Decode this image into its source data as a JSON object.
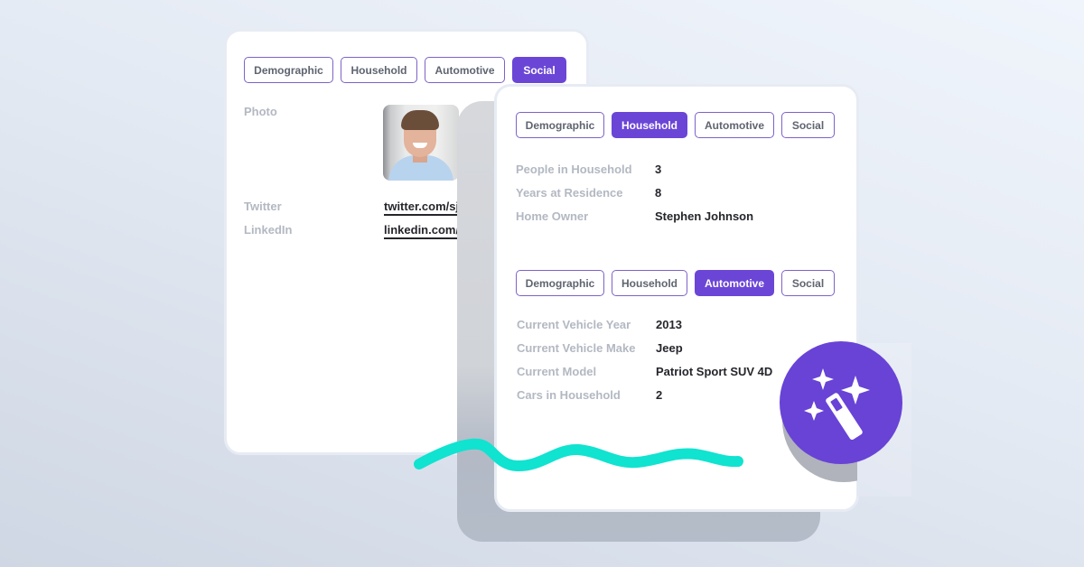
{
  "colors": {
    "accent": "#6b46d6",
    "tab_border": "#7e63c8",
    "label_text": "#b3b8c2",
    "value_text": "#25262b",
    "squiggle": "#10e3d0",
    "background_light": "#f0f5fc",
    "background_dark": "#cfd7e4"
  },
  "social_card": {
    "tabs": [
      {
        "label": "Demographic",
        "active": false
      },
      {
        "label": "Household",
        "active": false
      },
      {
        "label": "Automotive",
        "active": false
      },
      {
        "label": "Social",
        "active": true
      }
    ],
    "fields": {
      "photo_label": "Photo",
      "twitter_label": "Twitter",
      "twitter_value": "twitter.com/sjohnson",
      "linkedin_label": "LinkedIn",
      "linkedin_value": "linkedin.com/in/stephenjohnson"
    }
  },
  "household_panel": {
    "tabs": [
      {
        "label": "Demographic",
        "active": false
      },
      {
        "label": "Household",
        "active": true
      },
      {
        "label": "Automotive",
        "active": false
      },
      {
        "label": "Social",
        "active": false
      }
    ],
    "fields": [
      {
        "label": "People in Household",
        "value": "3"
      },
      {
        "label": "Years at Residence",
        "value": "8"
      },
      {
        "label": "Home Owner",
        "value": "Stephen Johnson"
      }
    ]
  },
  "automotive_panel": {
    "tabs": [
      {
        "label": "Demographic",
        "active": false
      },
      {
        "label": "Household",
        "active": false
      },
      {
        "label": "Automotive",
        "active": true
      },
      {
        "label": "Social",
        "active": false
      }
    ],
    "fields": [
      {
        "label": "Current Vehicle Year",
        "value": "2013"
      },
      {
        "label": "Current Vehicle Make",
        "value": "Jeep"
      },
      {
        "label": "Current Model",
        "value": "Patriot Sport SUV 4D"
      },
      {
        "label": "Cars in Household",
        "value": "2"
      }
    ]
  },
  "badge": {
    "icon": "magic-wand-icon"
  }
}
